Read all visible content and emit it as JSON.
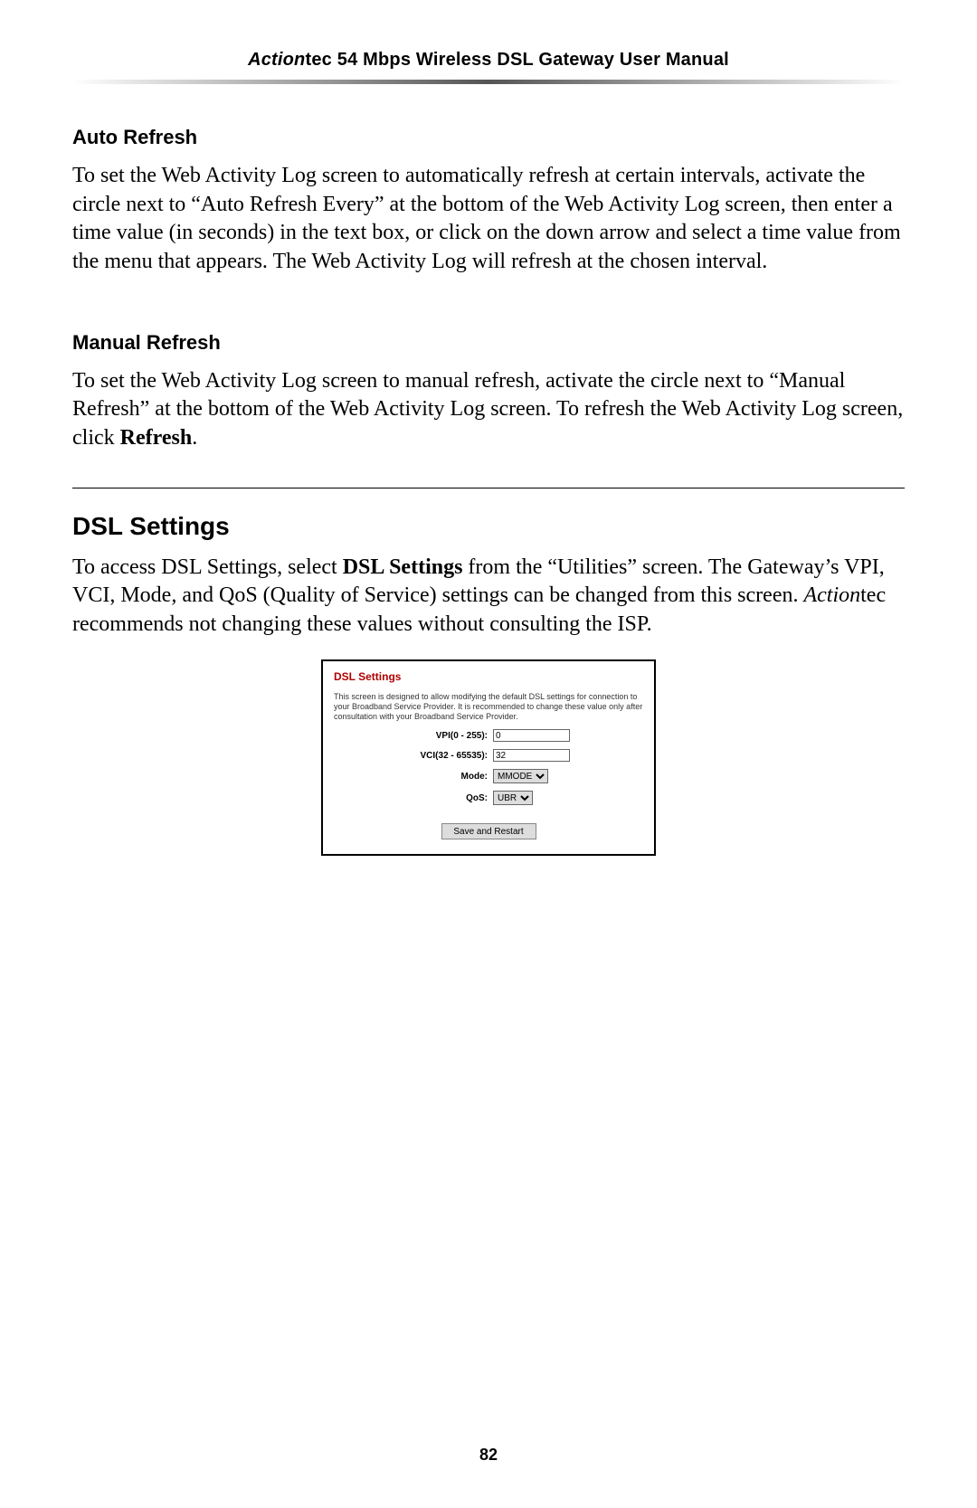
{
  "header": {
    "brand_italic": "Action",
    "brand_rest": "tec 54 Mbps Wireless DSL Gateway User Manual"
  },
  "section_auto": {
    "title": "Auto Refresh",
    "body": "To set the Web Activity Log screen to automatically refresh at certain intervals, activate the circle next to “Auto Refresh Every” at the bottom of the Web Activity Log screen, then enter a time value (in seconds) in the text box, or click on the down arrow and select a time value from the menu that appears. The Web Activity Log will refresh at the chosen interval."
  },
  "section_manual": {
    "title": "Manual Refresh",
    "body_pre": "To set the Web Activity Log screen to manual refresh, activate the circle next to “Manual Refresh” at the bottom of the Web Activity Log screen. To refresh the Web Activity Log screen, click ",
    "body_bold": "Refresh",
    "body_post": "."
  },
  "section_dsl": {
    "title": "DSL Settings",
    "body_p1a": "To access ",
    "body_p1b": "DSL",
    "body_p1c": " Settings, select ",
    "body_p1_bold1": "DSL Settings",
    "body_p1d": " from the “Utilities” screen. The Gateway’s ",
    "body_p1e": "VPI",
    "body_p1f": ", ",
    "body_p1g": "VCI",
    "body_p1h": ", Mode, and QoS (Quality of Service) settings can be changed from this screen. ",
    "body_p1_ital": "Action",
    "body_p1i": "tec recommends not changing these values without consulting the ",
    "body_p1j": "ISP",
    "body_p1k": "."
  },
  "panel": {
    "title": "DSL Settings",
    "desc": "This screen is designed to allow modifying the default DSL settings for connection to your Broadband Service Provider. It is recommended to change these value only after consultation with your Broadband Service Provider.",
    "vpi_label": "VPI(0 - 255):",
    "vpi_value": "0",
    "vci_label": "VCI(32 - 65535):",
    "vci_value": "32",
    "mode_label": "Mode:",
    "mode_value": "MMODE",
    "qos_label": "QoS:",
    "qos_value": "UBR",
    "save_label": "Save and Restart"
  },
  "page_number": "82"
}
